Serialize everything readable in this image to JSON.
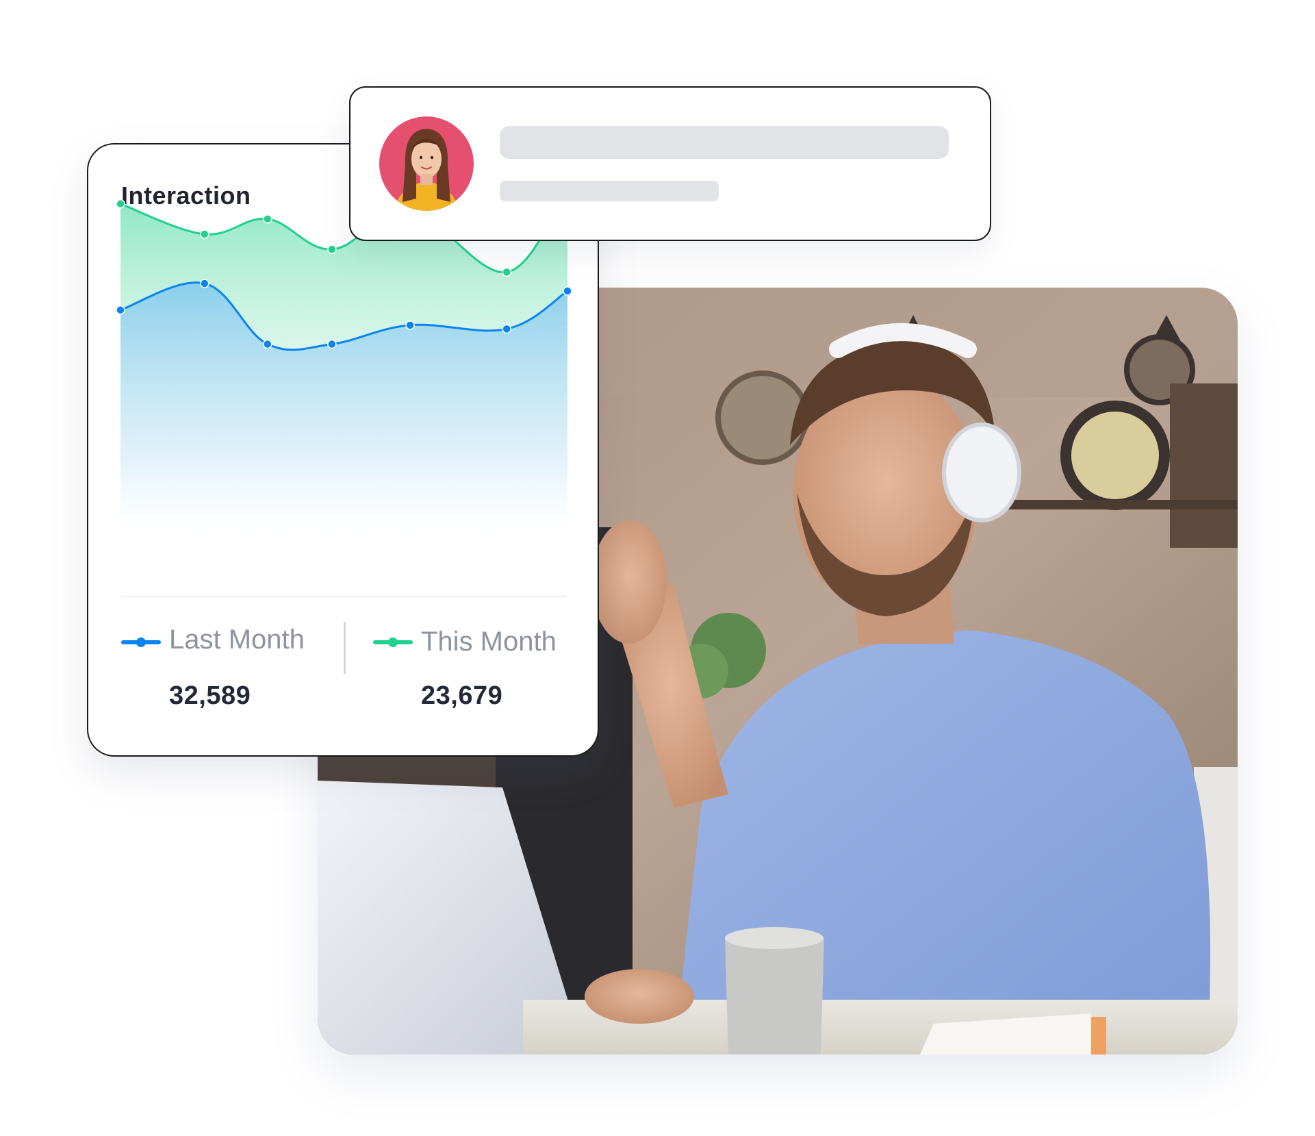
{
  "chart_card": {
    "title": "Interaction",
    "legend": [
      {
        "label": "Last Month",
        "value": "32,589",
        "color": "#0a84f0"
      },
      {
        "label": "This Month",
        "value": "23,679",
        "color": "#1fd18e"
      }
    ]
  },
  "profile_card": {
    "avatar_icon": "woman-portrait",
    "bg_color": "#e5506f"
  },
  "photo": {
    "subject": "man-with-headphones-at-laptop"
  },
  "chart_data": {
    "type": "area",
    "title": "Interaction",
    "x": [
      1,
      2,
      3,
      4,
      5,
      6,
      7
    ],
    "series": [
      {
        "name": "Last Month",
        "color": "#0a84f0",
        "values": [
          62,
          69,
          53,
          53,
          58,
          57,
          67
        ]
      },
      {
        "name": "This Month",
        "color": "#1fd18e",
        "values": [
          90,
          82,
          86,
          78,
          88,
          72,
          95
        ]
      }
    ],
    "ylim": [
      0,
      100
    ],
    "grid": false,
    "legend": "bottom"
  }
}
